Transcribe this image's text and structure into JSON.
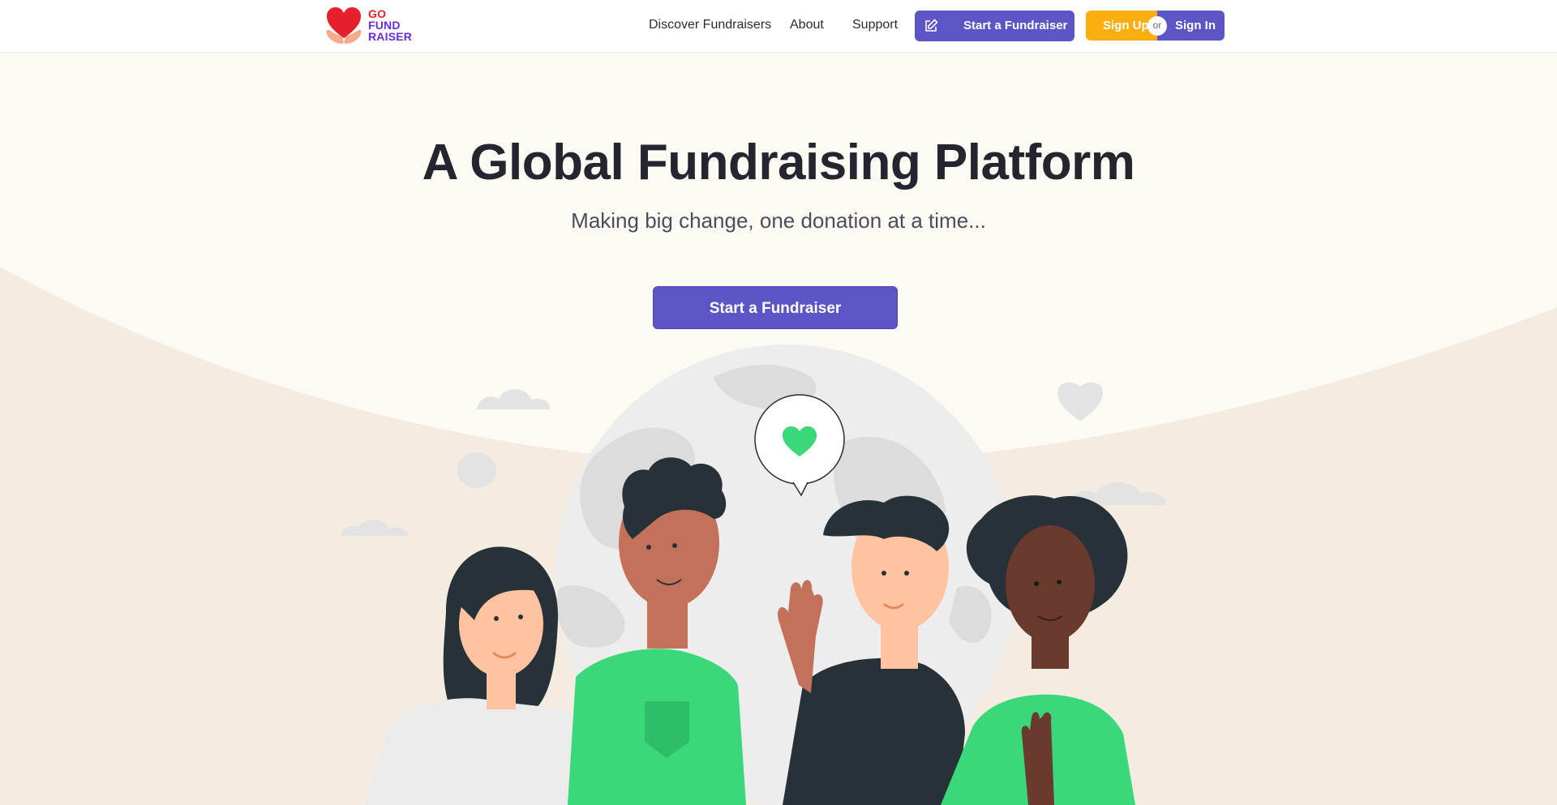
{
  "header": {
    "logo": {
      "line1": "GO",
      "line2": "FUND",
      "line3": "RAISER"
    },
    "nav": [
      {
        "label": "Discover Fundraisers"
      },
      {
        "label": "About"
      },
      {
        "label": "Support"
      }
    ],
    "start_button": {
      "label": "Start a Fundraiser",
      "icon": "edit-icon"
    },
    "auth": {
      "sign_up": "Sign Up",
      "or": "or",
      "sign_in": "Sign In"
    }
  },
  "hero": {
    "title": "A Global Fundraising Platform",
    "subtitle": "Making big change, one donation at a time...",
    "cta_label": "Start a Fundraiser"
  },
  "colors": {
    "primary": "#5b55c6",
    "accent": "#fbae0f",
    "logo_red": "#e5202b",
    "logo_purple": "#6d2bd9",
    "hero_bg": "#fdfaf4",
    "wave_bg": "#f4ece0",
    "illustration_green": "#3ad77b"
  }
}
